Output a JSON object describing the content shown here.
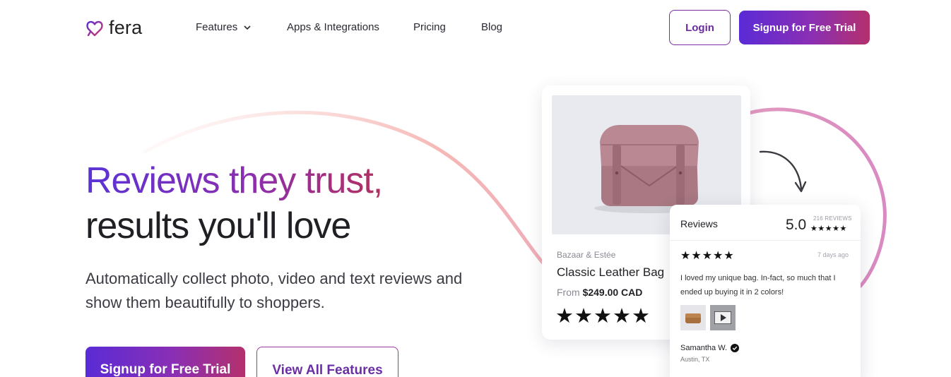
{
  "brand": {
    "logo_text": "fera",
    "accent_gradient": [
      "#5a2bd6",
      "#8a2fb4",
      "#b4306c"
    ]
  },
  "nav": {
    "items": [
      {
        "label": "Features",
        "has_dropdown": true
      },
      {
        "label": "Apps & Integrations"
      },
      {
        "label": "Pricing"
      },
      {
        "label": "Blog"
      }
    ],
    "login_label": "Login",
    "signup_label": "Signup for Free Trial"
  },
  "hero": {
    "headline_line1": "Reviews they trust,",
    "headline_line2": "results you'll love",
    "subtitle": "Automatically collect photo, video and text reviews and show them beautifully to shoppers.",
    "primary_cta": "Signup for Free Trial",
    "secondary_cta": "View All Features"
  },
  "product_card": {
    "brand": "Bazaar & Estée",
    "name": "Classic Leather Bag",
    "price_prefix": "From",
    "price": "$249.00 CAD",
    "stars": "★★★★★"
  },
  "reviews_card": {
    "title": "Reviews",
    "score": "5.0",
    "count": "216 REVIEWS",
    "summary_stars": "★★★★★",
    "review": {
      "stars": "★★★★★",
      "date": "7 days ago",
      "body": "I loved my unique bag. In-fact, so much that I ended up buying it in 2 colors!",
      "author": "Samantha W.",
      "location": "Austin, TX"
    }
  }
}
